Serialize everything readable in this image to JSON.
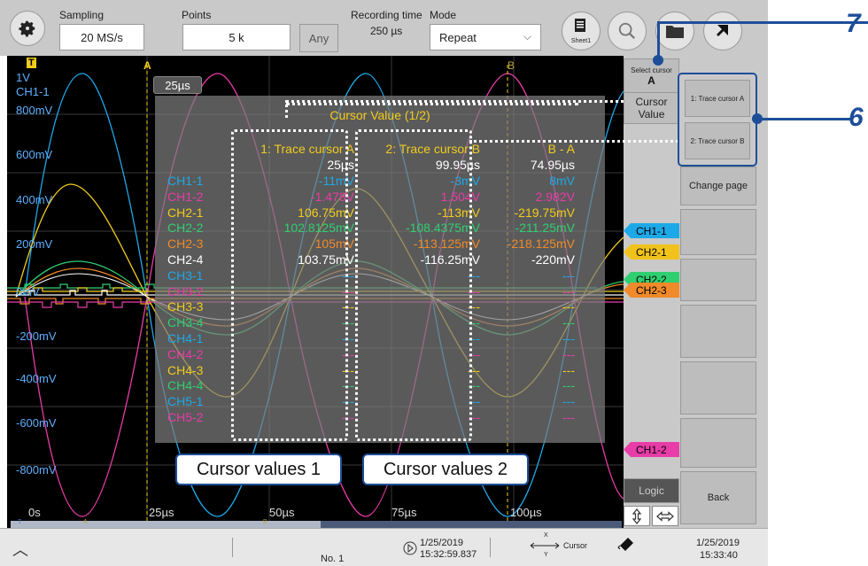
{
  "top": {
    "sampling_label": "Sampling",
    "sampling_value": "20 MS/s",
    "points_label": "Points",
    "points_value": "5 k",
    "any_button": "Any",
    "recording_label": "Recording time",
    "recording_value": "250 µs",
    "mode_label": "Mode",
    "mode_value": "Repeat",
    "sheet_label": "Sheet1"
  },
  "screen": {
    "cursor_a_label": "A",
    "cursor_b_label": "B",
    "t_marker": "T",
    "delta_time": "25µs",
    "y_labels": [
      "1V",
      "CH1-1",
      "800mV",
      "600mV",
      "400mV",
      "200mV",
      "0mV",
      "-200mV",
      "-400mV",
      "-600mV",
      "-800mV"
    ],
    "x_labels": [
      "0s",
      "25µs",
      "50µs",
      "75µs",
      "100µs"
    ],
    "scroll_marks": [
      "T",
      "A",
      "B"
    ]
  },
  "cursor_values": {
    "title": "Cursor Value (1/2)",
    "col_a_header": "1: Trace cursor A",
    "col_b_header": "2: Trace cursor B",
    "col_ba_header": "B - A",
    "time_row": [
      "25µs",
      "99.95µs",
      "74.95µs"
    ],
    "rows": [
      {
        "name": "CH1-1",
        "a": "-11mV",
        "b": "-3mV",
        "ba": "8mV",
        "color": "#1da9e8"
      },
      {
        "name": "CH1-2",
        "a": "-1.478V",
        "b": "1.504V",
        "ba": "2.982V",
        "color": "#e83ca8"
      },
      {
        "name": "CH2-1",
        "a": "106.75mV",
        "b": "-113mV",
        "ba": "-219.75mV",
        "color": "#f2cc1c"
      },
      {
        "name": "CH2-2",
        "a": "102.8125mV",
        "b": "-108.4375mV",
        "ba": "-211.25mV",
        "color": "#2fcf70"
      },
      {
        "name": "CH2-3",
        "a": "105mV",
        "b": "-113.125mV",
        "ba": "-218.125mV",
        "color": "#f08a2a"
      },
      {
        "name": "CH2-4",
        "a": "103.75mV",
        "b": "-116.25mV",
        "ba": "-220mV",
        "color": "#ffffff"
      },
      {
        "name": "CH3-1",
        "a": "---",
        "b": "---",
        "ba": "---",
        "color": "#1da9e8"
      },
      {
        "name": "CH3-2",
        "a": "---",
        "b": "---",
        "ba": "---",
        "color": "#e83ca8"
      },
      {
        "name": "CH3-3",
        "a": "---",
        "b": "---",
        "ba": "---",
        "color": "#f2cc1c"
      },
      {
        "name": "CH3-4",
        "a": "---",
        "b": "---",
        "ba": "---",
        "color": "#2fcf70"
      },
      {
        "name": "CH4-1",
        "a": "---",
        "b": "---",
        "ba": "---",
        "color": "#1da9e8"
      },
      {
        "name": "CH4-2",
        "a": "---",
        "b": "---",
        "ba": "---",
        "color": "#e83ca8"
      },
      {
        "name": "CH4-3",
        "a": "---",
        "b": "---",
        "ba": "---",
        "color": "#f2cc1c"
      },
      {
        "name": "CH4-4",
        "a": "---",
        "b": "---",
        "ba": "---",
        "color": "#2fcf70"
      },
      {
        "name": "CH5-1",
        "a": "---",
        "b": "---",
        "ba": "---",
        "color": "#1da9e8"
      },
      {
        "name": "CH5-2",
        "a": "---",
        "b": "---",
        "ba": "---",
        "color": "#e83ca8"
      }
    ]
  },
  "right_tags": [
    {
      "label": "CH1-1",
      "color": "#1da9e8"
    },
    {
      "label": "CH2-1",
      "color": "#f2c21c"
    },
    {
      "label": "CH2-2",
      "color": "#2fcf70"
    },
    {
      "label": "CH2-3",
      "color": "#f08a2a"
    },
    {
      "label": "CH1-2",
      "color": "#e83ca8"
    }
  ],
  "right_panel": {
    "select_cursor": "Select cursor",
    "select_cursor_value": "A",
    "cursor_value_btn": "Cursor Value",
    "trace_a_btn": "1: Trace cursor A",
    "trace_b_btn": "2: Trace cursor B",
    "change_page": "Change page",
    "back": "Back",
    "logic": "Logic"
  },
  "callouts": {
    "values1": "Cursor values 1",
    "values2": "Cursor values 2",
    "num6": "6",
    "num7": "7"
  },
  "status": {
    "no_label": "No. 1",
    "date1": "1/25/2019",
    "time1": "15:32:59.837",
    "cursor_label": "Cursor",
    "x_label": "X",
    "y_label": "Y",
    "date2": "1/25/2019",
    "time2": "15:33:40"
  }
}
